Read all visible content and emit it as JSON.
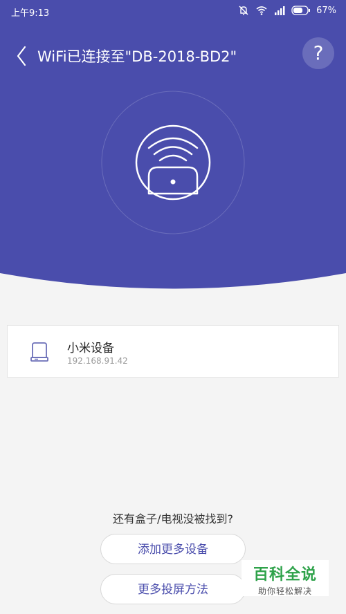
{
  "colors": {
    "header_bg": "#4a4dac",
    "page_bg": "#f4f4f4",
    "accent": "#4a4dac",
    "watermark_green": "#2ea24a"
  },
  "status_bar": {
    "time": "上午9:13",
    "battery": "67%",
    "icons": [
      "mute-bell-icon",
      "wifi-icon",
      "signal-icon",
      "battery-icon"
    ]
  },
  "header": {
    "title": "WiFi已连接至\"DB-2018-BD2\"",
    "help_label": "?",
    "back_icon": "chevron-left-icon",
    "help_icon": "question-mark-icon"
  },
  "hero": {
    "icon": "wifi-router-icon"
  },
  "device": {
    "name": "小米设备",
    "ip": "192.168.91.42",
    "icon": "box-device-icon"
  },
  "footer": {
    "hint": "还有盒子/电视没被找到?",
    "add_button": "添加更多设备",
    "more_button": "更多投屏方法"
  },
  "watermark": {
    "title": "百科全说",
    "subtitle": "助你轻松解决"
  }
}
